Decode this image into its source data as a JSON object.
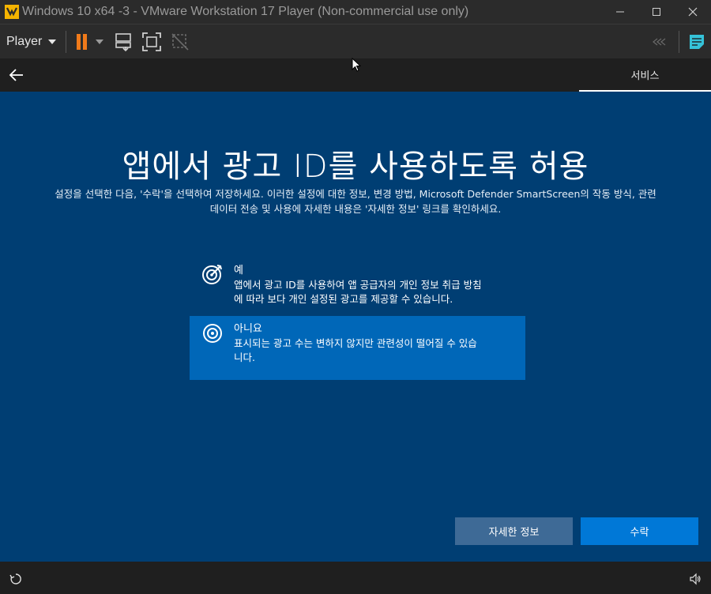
{
  "window": {
    "title": "Windows 10 x64 -3 - VMware Workstation 17 Player (Non-commercial use only)",
    "logo": "vmware-logo",
    "controls": [
      "minimize-icon",
      "maximize-icon",
      "close-icon"
    ]
  },
  "toolbar": {
    "player_label": "Player",
    "icons": [
      "pause-icon",
      "send-ctrl-alt-del-icon",
      "fullscreen-icon",
      "unity-icon",
      "collapse-arrows-icon",
      "notes-icon"
    ],
    "accent_pause": "#f07a1a",
    "accent_notes": "#35c2d8"
  },
  "oobe": {
    "tab": "서비스",
    "heading": "앱에서 광고 ID를 사용하도록 허용",
    "description_line1": "설정을 선택한 다음, '수락'을 선택하여 저장하세요. 이러한 설정에 대한 정보, 변경 방법, Microsoft Defender SmartScreen의 작동 방식, 관련",
    "description_line2": "데이터 전송 및 사용에 자세한 내용은 '자세한 정보' 링크를 확인하세요.",
    "options": [
      {
        "title": "예",
        "body_line1": "앱에서 광고 ID를 사용하여 앱 공급자의 개인 정보 취급 방침",
        "body_line2": "에 따라 보다 개인 설정된 광고를 제공할 수 있습니다.",
        "icon": "target-icon",
        "selected": false
      },
      {
        "title": "아니요",
        "body_line1": "표시되는 광고 수는 변하지 않지만 관련성이 떨어질 수 있습",
        "body_line2": "니다.",
        "icon": "radio-target-icon",
        "selected": true
      }
    ],
    "learn_more_button": "자세한 정보",
    "accept_button": "수락",
    "colors": {
      "background": "#003e73",
      "selected_option": "#0067b8",
      "accept_button": "#0078d7",
      "learn_button": "#3e6a96"
    }
  },
  "bottom_bar": {
    "icons": [
      "ease-of-access-icon",
      "volume-icon"
    ]
  }
}
